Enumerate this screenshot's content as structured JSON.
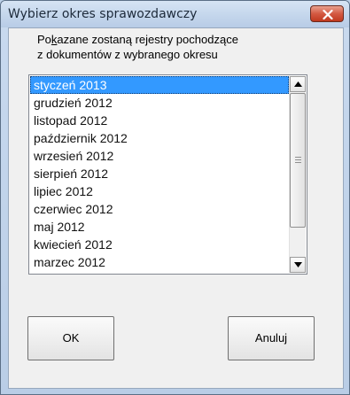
{
  "dialog": {
    "title": "Wybierz okres sprawozdawczy",
    "close_icon": "close-icon"
  },
  "description": {
    "line1_prefix": "Po",
    "line1_mnemonic": "k",
    "line1_suffix": "azane zostaną rejestry pochodzące",
    "line2": "z dokumentów z wybranego okresu"
  },
  "period_list": {
    "selected": "styczeń 2013",
    "items": [
      "styczeń 2013",
      "grudzień 2012",
      "listopad 2012",
      "październik 2012",
      "wrzesień 2012",
      "sierpień 2012",
      "lipiec 2012",
      "czerwiec 2012",
      "maj 2012",
      "kwiecień 2012",
      "marzec 2012"
    ]
  },
  "buttons": {
    "ok_label": "OK",
    "cancel_label": "Anuluj"
  }
}
